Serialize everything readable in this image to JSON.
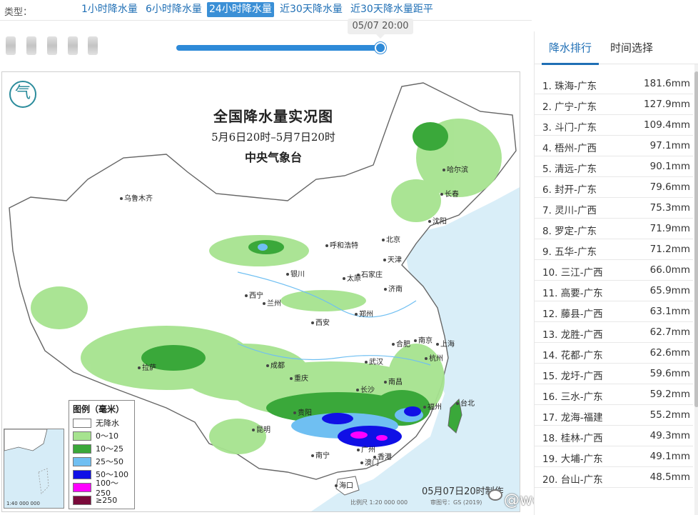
{
  "type_bar": {
    "label": "类型：",
    "tabs": [
      {
        "label": "1小时降水量",
        "active": false
      },
      {
        "label": "6小时降水量",
        "active": false
      },
      {
        "label": "24小时降水量",
        "active": true
      },
      {
        "label": "近30天降水量",
        "active": false
      },
      {
        "label": "近30天降水量距平",
        "active": false
      }
    ]
  },
  "slider": {
    "current_time": "05/07 20:00",
    "progress_percent": 100
  },
  "map": {
    "title": "全国降水量实况图",
    "subtitle": "5月6日20时–5月7日20时",
    "org": "中央气象台",
    "logo_glyph": "气",
    "cities": [
      "乌鲁木齐",
      "哈尔滨",
      "长春",
      "沈阳",
      "呼和浩特",
      "北京",
      "天津",
      "银川",
      "太原",
      "石家庄",
      "济南",
      "西宁",
      "兰州",
      "西安",
      "郑州",
      "合肥",
      "南京",
      "上海",
      "杭州",
      "武汉",
      "拉萨",
      "成都",
      "重庆",
      "长沙",
      "南昌",
      "福州",
      "台北",
      "贵阳",
      "昆明",
      "南宁",
      "广州",
      "香港",
      "澳门",
      "海口"
    ],
    "made_time": "05月07日20时制作",
    "scale": "比例尺 1:20 000 000",
    "review_no": "审图号：GS (2019)",
    "inset_scale": "1:40 000 000",
    "watermark": "@weatherman_信欣",
    "legend": {
      "title": "图例（毫米）",
      "items": [
        {
          "label": "无降水",
          "color": "#ffffff"
        },
        {
          "label": "0～10",
          "color": "#a6e38f"
        },
        {
          "label": "10～25",
          "color": "#3aa83a"
        },
        {
          "label": "25～50",
          "color": "#6fbff2"
        },
        {
          "label": "50～100",
          "color": "#1010e6"
        },
        {
          "label": "100～250",
          "color": "#ff00ff"
        },
        {
          "label": "≥250",
          "color": "#7a0a3a"
        }
      ]
    }
  },
  "right_panel": {
    "tabs": [
      {
        "label": "降水排行",
        "active": true
      },
      {
        "label": "时间选择",
        "active": false
      }
    ],
    "ranking": [
      {
        "name": "1. 珠海-广东",
        "value": "181.6mm"
      },
      {
        "name": "2. 广宁-广东",
        "value": "127.9mm"
      },
      {
        "name": "3. 斗门-广东",
        "value": "109.4mm"
      },
      {
        "name": "4. 梧州-广西",
        "value": "97.1mm"
      },
      {
        "name": "5. 清远-广东",
        "value": "90.1mm"
      },
      {
        "name": "6. 封开-广东",
        "value": "79.6mm"
      },
      {
        "name": "7. 灵川-广西",
        "value": "75.3mm"
      },
      {
        "name": "8. 罗定-广东",
        "value": "71.9mm"
      },
      {
        "name": "9. 五华-广东",
        "value": "71.2mm"
      },
      {
        "name": "10. 三江-广西",
        "value": "66.0mm"
      },
      {
        "name": "11. 高要-广东",
        "value": "65.9mm"
      },
      {
        "name": "12. 藤县-广西",
        "value": "63.1mm"
      },
      {
        "name": "13. 龙胜-广西",
        "value": "62.7mm"
      },
      {
        "name": "14. 花都-广东",
        "value": "62.6mm"
      },
      {
        "name": "15. 龙圩-广西",
        "value": "59.6mm"
      },
      {
        "name": "16. 三水-广东",
        "value": "59.2mm"
      },
      {
        "name": "17. 龙海-福建",
        "value": "55.2mm"
      },
      {
        "name": "18. 桂林-广西",
        "value": "49.3mm"
      },
      {
        "name": "19. 大埔-广东",
        "value": "49.1mm"
      },
      {
        "name": "20. 台山-广东",
        "value": "48.5mm"
      }
    ]
  }
}
